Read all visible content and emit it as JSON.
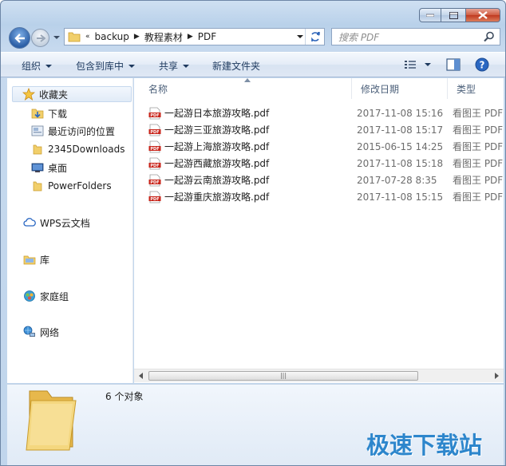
{
  "address": {
    "overflow_label": "«",
    "crumbs": [
      "backup",
      "教程素材",
      "PDF"
    ]
  },
  "search": {
    "placeholder": "搜索 PDF"
  },
  "toolbar": {
    "organize": "组织",
    "include_in_library": "包含到库中",
    "share": "共享",
    "new_folder": "新建文件夹"
  },
  "nav": {
    "favorites": "收藏夹",
    "downloads": "下载",
    "recent": "最近访问的位置",
    "downloads2345": "2345Downloads",
    "desktop": "桌面",
    "powerfolders": "PowerFolders",
    "wps_cloud": "WPS云文档",
    "library": "库",
    "homegroup": "家庭组",
    "network": "网络"
  },
  "columns": {
    "name": "名称",
    "date": "修改日期",
    "type": "类型"
  },
  "files": [
    {
      "name": "一起游日本旅游攻略.pdf",
      "date": "2017-11-08 15:16",
      "type": "看图王 PDF"
    },
    {
      "name": "一起游三亚旅游攻略.pdf",
      "date": "2017-11-08 15:17",
      "type": "看图王 PDF"
    },
    {
      "name": "一起游上海旅游攻略.pdf",
      "date": "2015-06-15 14:25",
      "type": "看图王 PDF"
    },
    {
      "name": "一起游西藏旅游攻略.pdf",
      "date": "2017-11-08 15:18",
      "type": "看图王 PDF"
    },
    {
      "name": "一起游云南旅游攻略.pdf",
      "date": "2017-07-28 8:35",
      "type": "看图王 PDF"
    },
    {
      "name": "一起游重庆旅游攻略.pdf",
      "date": "2017-11-08 15:15",
      "type": "看图王 PDF"
    }
  ],
  "status": {
    "count": "6 个对象"
  },
  "watermark": "极速下载站",
  "pdf_badge": "PDF",
  "colors": {
    "accent": "#2d86cc",
    "pdf_red": "#c8241a",
    "folder_yellow": "#f1cf6b"
  }
}
